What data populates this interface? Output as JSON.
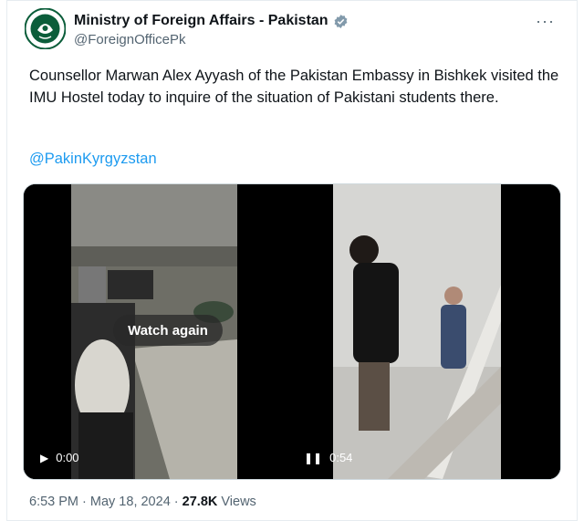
{
  "tweet": {
    "author_name": "Ministry of Foreign Affairs - Pakistan",
    "handle": "@ForeignOfficePk",
    "text": "Counsellor Marwan Alex Ayyash of the Pakistan Embassy in Bishkek visited the IMU Hostel today to inquire of the situation of Pakistani students there.",
    "mention": "@PakinKyrgyzstan",
    "time": "6:53 PM",
    "date": "May 18, 2024",
    "views_count": "27.8K",
    "views_label": "Views"
  },
  "media": {
    "video1": {
      "overlay": "Watch again",
      "time": "0:00",
      "icon": "play-icon"
    },
    "video2": {
      "time": "0:54",
      "icon": "pause-icon"
    }
  },
  "colors": {
    "link": "#1d9bf0",
    "verified": "#829aab",
    "avatar_green": "#0b5d3a"
  }
}
